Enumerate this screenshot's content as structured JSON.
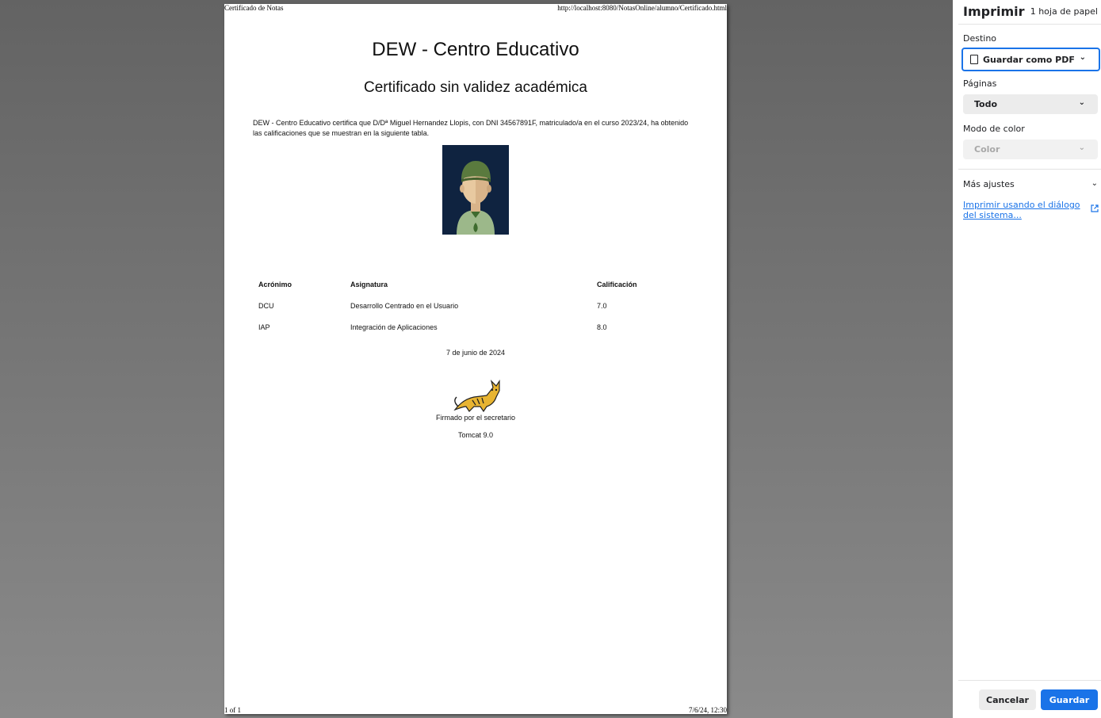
{
  "document": {
    "header_left": "Certificado de Notas",
    "header_right": "http://localhost:8080/NotasOnline/alumno/Certificado.html",
    "footer_left": "1 of 1",
    "footer_right": "7/6/24, 12:30",
    "title": "DEW - Centro Educativo",
    "subtitle": "Certificado sin validez académica",
    "intro_line1": "DEW - Centro Educativo certifica que D/Dª Miguel Hernandez Llopis, con DNI 34567891F, matriculado/a en el curso 2023/24, ha obtenido",
    "intro_line2": "las calificaciones que se muestran en la siguiente tabla.",
    "table": {
      "headers": [
        "Acrónimo",
        "Asignatura",
        "Calificación"
      ],
      "rows": [
        [
          "DCU",
          "Desarrollo Centrado en el Usuario",
          "7.0"
        ],
        [
          "IAP",
          "Integración de Aplicaciones",
          "8.0"
        ]
      ]
    },
    "date": "7 de junio de 2024",
    "signed_by": "Firmado por el secretario",
    "tomcat_version": "Tomcat 9.0"
  },
  "print_panel": {
    "title": "Imprimir",
    "sheets": "1 hoja de papel",
    "destination_label": "Destino",
    "destination_value": "Guardar como PDF",
    "pages_label": "Páginas",
    "pages_value": "Todo",
    "color_label": "Modo de color",
    "color_value": "Color",
    "more_settings": "Más ajustes",
    "system_dialog_link": "Imprimir usando el diálogo del sistema...",
    "cancel": "Cancelar",
    "save": "Guardar"
  },
  "icons": {
    "destination_icon": "document-icon",
    "dropdown": "chevron-down-icon",
    "external_link": "external-link-icon"
  },
  "colors": {
    "accent": "#1a73e8",
    "avatar_background": "#0f2340"
  }
}
